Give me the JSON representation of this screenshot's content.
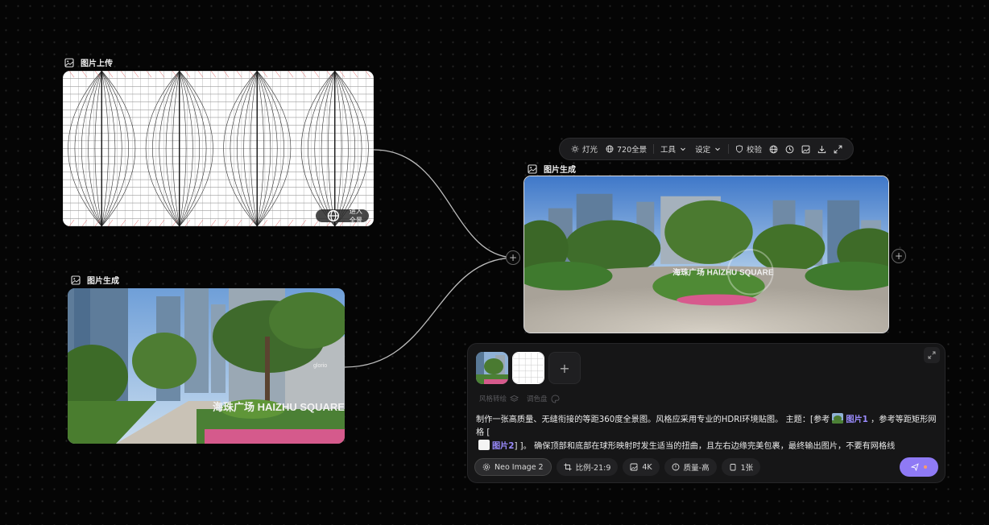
{
  "nodes": {
    "upload": {
      "label": "图片上传",
      "enter_pano_label": "进入全景"
    },
    "source": {
      "label": "图片生成"
    },
    "output": {
      "label": "图片生成",
      "sign_text": "海珠广场 HAIZHU SQUARE"
    }
  },
  "source_photo": {
    "sign_text": "海珠广场 HAIZHU SQUARE",
    "shop_text": "glorio"
  },
  "toolbar": {
    "lighting": "灯光",
    "pano720": "720全景",
    "tools": "工具",
    "settings": "设定",
    "verify": "校验"
  },
  "prompt_panel": {
    "style_transfer": "风格转绘",
    "palette": "调色盘",
    "text_part1": "制作一张高质量、无缝衔接的等距360度全景图。风格应采用专业的HDRI环境贴图。 主题：[参考",
    "ref1": "图片1",
    "text_part2": " ，参考等距矩形网格 [",
    "ref2": "图片2",
    "text_part3": "]  ]。 确保顶部和底部在球形映射时发生适当的扭曲，且左右边缘完美包裹，最终输出图片，不要有网格线",
    "model": "Neo Image 2",
    "ratio": "比例-21:9",
    "resolution": "4K",
    "quality": "质量-高",
    "count": "1张"
  },
  "colors": {
    "accent": "#8f7af5",
    "background": "#050505",
    "panel": "#161617"
  }
}
